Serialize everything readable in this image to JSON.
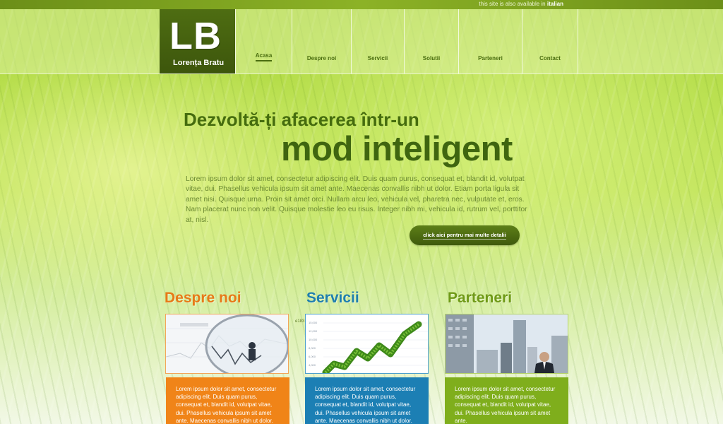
{
  "lang_notice": {
    "text": "this site is also available in",
    "language": "italian"
  },
  "logo": {
    "mark": "LB",
    "name": "Lorența Bratu"
  },
  "nav": {
    "items": [
      {
        "label": "Acasa",
        "active": true
      },
      {
        "label": "Despre noi",
        "active": false
      },
      {
        "label": "Servicii",
        "active": false
      },
      {
        "label": "Solutii",
        "active": false
      },
      {
        "label": "Parteneri",
        "active": false
      },
      {
        "label": "Contact",
        "active": false
      }
    ]
  },
  "hero": {
    "line1": "Dezvoltă-ți afacerea într-un",
    "line2": "mod inteligent",
    "text": "Lorem ipsum dolor sit amet, consectetur adipiscing elit. Duis quam purus, consequat et, blandit id, volutpat vitae, dui. Phasellus vehicula ipsum sit amet ante. Maecenas convallis nibh ut dolor. Etiam porta ligula sit amet nisi. Quisque urna. Proin sit amet orci. Nullam arcu leo, vehicula vel, pharetra nec, vulputate et, eros. Nam placerat nunc non velit. Quisque molestie leo eu risus. Integer nibh mi, vehicula id, rutrum vel, porttitor at, nisl.",
    "cta_label": "click aici pentru mai multe detalii"
  },
  "columns": [
    {
      "title": "Despre noi",
      "image": "magnifier-graph-businessman",
      "text": "Lorem ipsum dolor sit amet, consectetur adipiscing elit. Duis quam purus, consequat et, blandit id, volutpat vitae, dui. Phasellus vehicula ipsum sit amet ante. Maecenas convallis nibh ut dolor. Etiam porta ligula sit"
    },
    {
      "title": "Servicii",
      "image": "grass-growth-chart",
      "text": "Lorem ipsum dolor sit amet, consectetur adipiscing elit. Duis quam purus, consequat et, blandit id, volutpat vitae, dui. Phasellus vehicula ipsum sit amet ante. Maecenas convallis nibh ut dolor. Etiam porta ligula sit"
    },
    {
      "title": "Parteneri",
      "image": "businessman-city-skyline",
      "text": "Lorem ipsum dolor sit amet, consectetur adipiscing elit. Duis quam purus, consequat et, blandit id, volutpat vitae, dui. Phasellus vehicula ipsum sit amet ante."
    }
  ],
  "chart_tag": "e183",
  "chart_ticks": [
    "15,000",
    "12,000",
    "10,000",
    "8,000",
    "6,000",
    "4,000"
  ],
  "colors": {
    "accent_green": "#4a6d0f",
    "orange": "#f08418",
    "blue": "#1c7fb4",
    "light_green": "#7fae1c"
  }
}
